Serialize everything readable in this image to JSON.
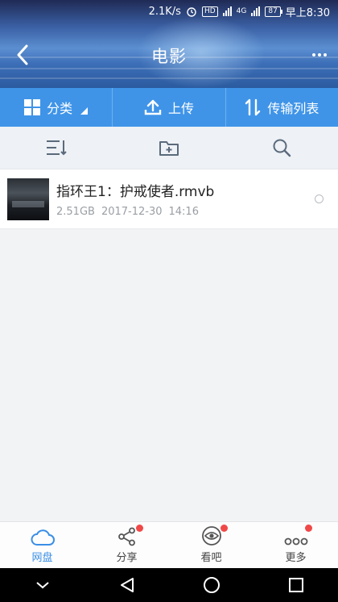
{
  "status_bar": {
    "speed": "2.1K/s",
    "hd_badge": "HD",
    "network_4g": "4G",
    "battery": "87",
    "time": "早上8:30"
  },
  "header": {
    "title": "电影",
    "back_icon": "chevron-left-icon",
    "more_icon": "more-dots-icon"
  },
  "action_bar": [
    {
      "label": "分类",
      "icon": "grid-icon"
    },
    {
      "label": "上传",
      "icon": "upload-icon"
    },
    {
      "label": "传输列表",
      "icon": "transfer-arrows-icon"
    }
  ],
  "toolbar": {
    "sort_icon": "sort-icon",
    "new_folder_icon": "new-folder-icon",
    "search_icon": "search-icon"
  },
  "files": [
    {
      "name": "指环王1：护戒使者.rmvb",
      "size": "2.51GB",
      "date": "2017-12-30",
      "time": "14:16"
    }
  ],
  "tabs": [
    {
      "label": "网盘",
      "active": true,
      "badge": false
    },
    {
      "label": "分享",
      "active": false,
      "badge": true
    },
    {
      "label": "看吧",
      "active": false,
      "badge": true
    },
    {
      "label": "更多",
      "active": false,
      "badge": true
    }
  ],
  "colors": {
    "accent": "#3f94e8",
    "active_tab": "#3a8ee6",
    "badge": "#f04848"
  }
}
